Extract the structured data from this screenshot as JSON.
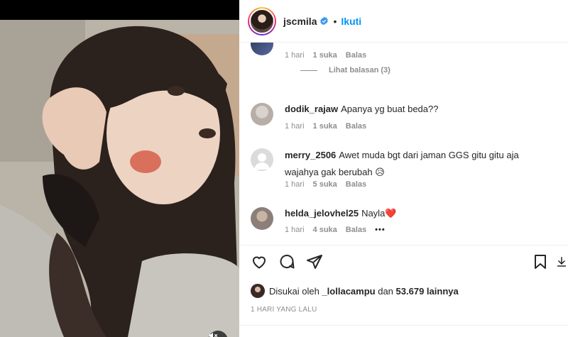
{
  "post": {
    "username": "jscmila",
    "follow_label": "Ikuti",
    "separator": "•"
  },
  "comments": [
    {
      "meta_time": "1 hari",
      "meta_likes": "1 suka",
      "reply_label": "Balas",
      "view_replies": "Lihat balasan (3)"
    },
    {
      "user": "dodik_rajaw",
      "text": "Apanya yg buat beda??",
      "meta_time": "1 hari",
      "meta_likes": "1 suka",
      "reply_label": "Balas"
    },
    {
      "user": "merry_2506",
      "text": "Awet muda bgt dari jaman GGS gitu gitu aja wajahya gak berubah 😥",
      "meta_time": "1 hari",
      "meta_likes": "5 suka",
      "reply_label": "Balas"
    },
    {
      "user": "helda_jelovhel25",
      "text": "Nayla❤️",
      "meta_time": "1 hari",
      "meta_likes": "4 suka",
      "reply_label": "Balas",
      "more": "•••"
    }
  ],
  "likes": {
    "prefix": "Disukai oleh",
    "liker": "_lollacampu",
    "middle": "dan",
    "count": "53.679 lainnya"
  },
  "timestamp": "1 HARI YANG LALU",
  "colors": {
    "accent": "#0095f6",
    "verified": "#3897f0",
    "heart": "#ed4956",
    "muted": "#8e8e8e"
  },
  "carousel": {
    "active_index": 2,
    "count": 2
  }
}
